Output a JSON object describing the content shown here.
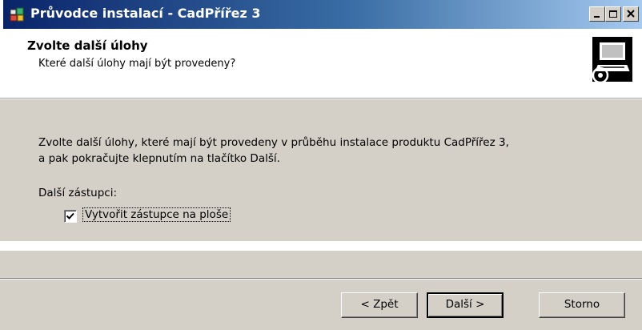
{
  "window": {
    "title": "Průvodce instalací - CadPřířez 3",
    "icon": "installer-icon",
    "controls": [
      "minimize-icon",
      "maximize-icon",
      "close-icon"
    ]
  },
  "header": {
    "title": "Zvolte další úlohy",
    "subtitle": "Které další úlohy mají být provedeny?",
    "logo": "computer-setup-icon"
  },
  "main": {
    "description_line1": "Zvolte další úlohy, které mají být provedeny v průběhu instalace produktu CadPřířez 3,",
    "description_line2": "a pak pokračujte klepnutím na tlačítko Další.",
    "group_label": "Další zástupci:",
    "tasks": [
      {
        "label": "Vytvořit zástupce na ploše",
        "checked": true
      }
    ]
  },
  "footer": {
    "back_label": "< Zpět",
    "next_label": "Další >",
    "cancel_label": "Storno"
  },
  "colors": {
    "titlebar_start": "#0a246a",
    "titlebar_end": "#a6caf0",
    "dialog_face": "#d4d0c8"
  }
}
